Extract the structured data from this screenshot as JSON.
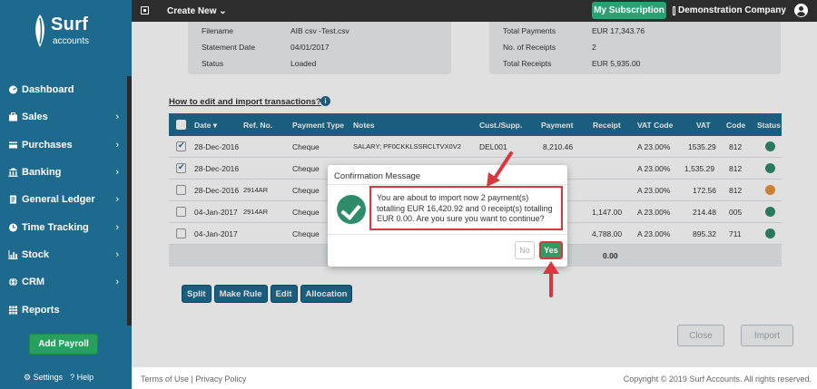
{
  "brand": {
    "name": "Surf",
    "sub": "accounts"
  },
  "sidebar": {
    "items": [
      {
        "label": "Dashboard",
        "icon": "dashboard-icon",
        "chevron": false
      },
      {
        "label": "Sales",
        "icon": "briefcase-icon",
        "chevron": true
      },
      {
        "label": "Purchases",
        "icon": "card-icon",
        "chevron": true
      },
      {
        "label": "Banking",
        "icon": "bank-icon",
        "chevron": true
      },
      {
        "label": "General Ledger",
        "icon": "document-icon",
        "chevron": true
      },
      {
        "label": "Time Tracking",
        "icon": "clock-icon",
        "chevron": true
      },
      {
        "label": "Stock",
        "icon": "bar-chart-icon",
        "chevron": true
      },
      {
        "label": "CRM",
        "icon": "globe-icon",
        "chevron": true
      },
      {
        "label": "Reports",
        "icon": "table-icon",
        "chevron": false
      }
    ],
    "add_payroll": "Add Payroll",
    "settings": "Settings",
    "help": "Help"
  },
  "topbar": {
    "create_new": "Create New",
    "my_subscription": "My Subscription",
    "company": "Demonstration Company"
  },
  "info": {
    "left": [
      {
        "label": "Filename",
        "value": "AIB csv -Test.csv"
      },
      {
        "label": "Statement Date",
        "value": "04/01/2017"
      },
      {
        "label": "Status",
        "value": "Loaded"
      }
    ],
    "right": [
      {
        "label": "Total Payments",
        "value": "EUR 17,343.76"
      },
      {
        "label": "No. of Receipts",
        "value": "2"
      },
      {
        "label": "Total Receipts",
        "value": "EUR 5,935.00"
      }
    ]
  },
  "how_to_link": "How to edit and import transactions?",
  "table": {
    "headers": [
      "Date",
      "Ref. No.",
      "Payment Type",
      "Notes",
      "Cust./Supp.",
      "Payment",
      "Receipt",
      "VAT Code",
      "VAT",
      "Code",
      "Status"
    ],
    "rows": [
      {
        "checked": true,
        "date": "28-Dec-2016",
        "ref": "",
        "ptype": "Cheque",
        "notes": "SALARY; PF0CKKLSSRCLTVX0V2",
        "cust": "DEL001",
        "payment": "8,210.46",
        "receipt": "",
        "vatcode": "A 23.00%",
        "vat": "1535.29",
        "code": "812",
        "status_color": "#2e8b6a"
      },
      {
        "checked": true,
        "date": "28-Dec-2016",
        "ref": "",
        "ptype": "Cheque",
        "notes": "",
        "cust": "",
        "payment": "",
        "receipt": "",
        "vatcode": "A 23.00%",
        "vat": "1,535.29",
        "code": "812",
        "status_color": "#2e8b6a"
      },
      {
        "checked": false,
        "date": "28-Dec-2016",
        "ref": "2914AR",
        "ptype": "Cheque",
        "notes": "",
        "cust": "",
        "payment": "",
        "receipt": "",
        "vatcode": "A 23.00%",
        "vat": "172.56",
        "code": "812",
        "status_color": "#e8923a"
      },
      {
        "checked": false,
        "date": "04-Jan-2017",
        "ref": "2914AR",
        "ptype": "Cheque",
        "notes": "",
        "cust": "",
        "payment": "",
        "receipt": "1,147.00",
        "vatcode": "A 23.00%",
        "vat": "214.48",
        "code": "005",
        "status_color": "#2e8b6a"
      },
      {
        "checked": false,
        "date": "04-Jan-2017",
        "ref": "",
        "ptype": "Cheque",
        "notes": "",
        "cust": "",
        "payment": "",
        "receipt": "4,788.00",
        "vatcode": "A 23.00%",
        "vat": "895.32",
        "code": "711",
        "status_color": "#2e8b6a"
      }
    ],
    "total": "0.00"
  },
  "actions": [
    "Split",
    "Make Rule",
    "Edit",
    "Allocation"
  ],
  "bottom": {
    "close": "Close",
    "import": "Import"
  },
  "modal": {
    "title": "Confirmation Message",
    "message": "You are about to import now 2 payment(s) totalling EUR 16,420.92 and 0 receipt(s) totalling EUR 0.00. Are you sure you want to continue?",
    "no": "No",
    "yes": "Yes"
  },
  "footer": {
    "terms": "Terms of Use",
    "sep": " | ",
    "privacy": "Privacy Policy",
    "copyright": "Copyright © 2019 Surf Accounts. All rights reserved."
  },
  "colors": {
    "sidebar": "#1e6a8e",
    "accent_green": "#27a05e",
    "annotation_red": "#d9373f"
  }
}
